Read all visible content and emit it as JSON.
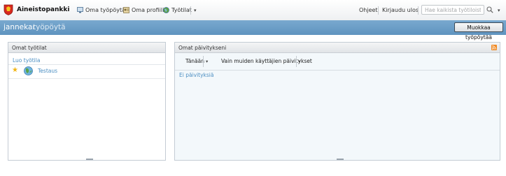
{
  "topbar": {
    "brand": "Aineistopankki",
    "nav": [
      {
        "label": "Oma työpöytä",
        "icon": "desktop-icon"
      },
      {
        "label": "Oma profiili",
        "icon": "profile-icon"
      },
      {
        "label": "Työtilat",
        "icon": "globe-icon"
      }
    ],
    "help_label": "Ohjeet",
    "logout_label": "Kirjaudu ulos",
    "search_placeholder": "Hae kaikista työtiloista"
  },
  "header": {
    "user": "jannekar",
    "title": "työpöytä",
    "edit_button": "Muokkaa työpöytää"
  },
  "left_panel": {
    "title": "Omat työtilat",
    "add_link": "Luo työtila",
    "workspaces": [
      {
        "name": "Testaus",
        "starred": true
      }
    ]
  },
  "right_panel": {
    "title": "Omat päivitykseni",
    "filter_time": "Tänään",
    "filter_others": "Vain muiden käyttäjien päivitykset",
    "empty_message": "Ei päivityksiä"
  },
  "colors": {
    "header_blue": "#6a9ec8",
    "link_blue": "#4b8ec2",
    "star_yellow": "#f2b515"
  }
}
